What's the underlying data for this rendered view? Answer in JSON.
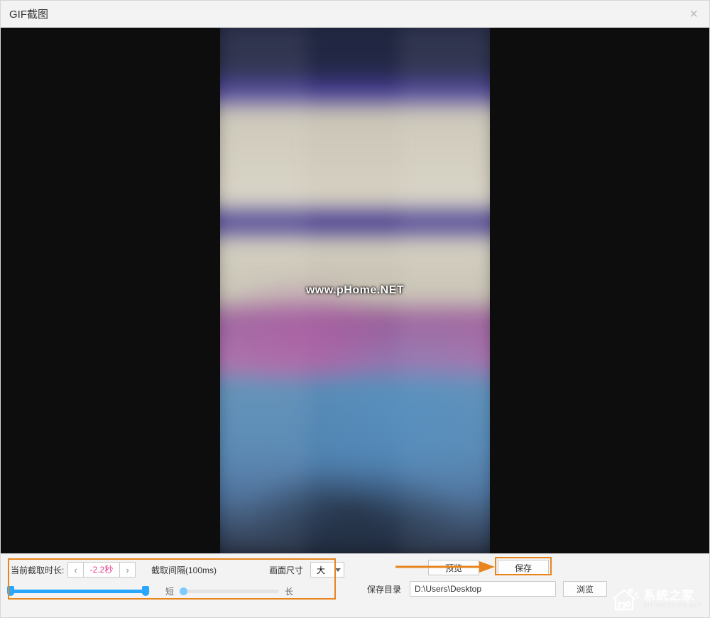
{
  "window": {
    "title": "GIF截图",
    "close_glyph": "×"
  },
  "preview": {
    "watermark": "www.pHome.NET"
  },
  "controls": {
    "duration_label": "当前截取时长:",
    "duration_value": "-2.2秒",
    "stepper_prev": "‹",
    "stepper_next": "›",
    "interval_label": "截取间隔(100ms)",
    "short_label": "短",
    "long_label": "长",
    "size_label": "画面尺寸",
    "size_value": "大",
    "preview_btn": "预览",
    "save_btn": "保存",
    "savedir_label": "保存目录",
    "path_value": "D:\\Users\\Desktop",
    "browse_btn": "浏览",
    "duration_slider": {
      "start_pct": 0,
      "end_pct": 97
    },
    "interval_slider": {
      "pos_pct": 0
    }
  },
  "site_logo": {
    "cn": "系统之家",
    "en": "XITONGZHIJIA.NET"
  }
}
